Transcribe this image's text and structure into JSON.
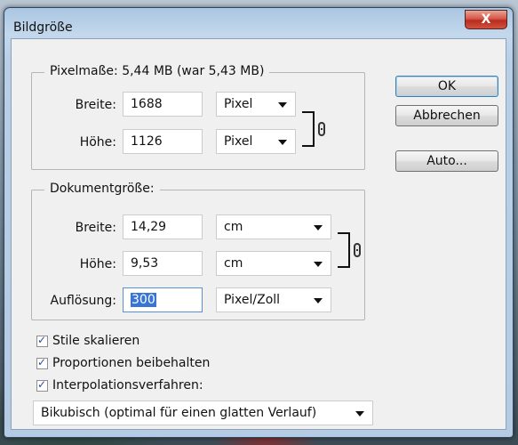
{
  "window": {
    "title": "Bildgröße",
    "close_label": "X"
  },
  "pixel_dimensions": {
    "legend": "Pixelmaße: 5,44 MB (war 5,43 MB)",
    "width_label": "Breite:",
    "width_value": "1688",
    "width_unit": "Pixel",
    "height_label": "Höhe:",
    "height_value": "1126",
    "height_unit": "Pixel",
    "link_icon": "chain-link-icon"
  },
  "document_size": {
    "legend": "Dokumentgröße:",
    "width_label": "Breite:",
    "width_value": "14,29",
    "width_unit": "cm",
    "height_label": "Höhe:",
    "height_value": "9,53",
    "height_unit": "cm",
    "resolution_label": "Auflösung:",
    "resolution_value": "300",
    "resolution_unit": "Pixel/Zoll",
    "link_icon": "chain-link-icon"
  },
  "buttons": {
    "ok": "OK",
    "cancel": "Abbrechen",
    "auto": "Auto..."
  },
  "options": {
    "scale_styles": {
      "label": "Stile skalieren",
      "checked": true
    },
    "constrain_proportions": {
      "label": "Proportionen beibehalten",
      "checked": true
    },
    "resample": {
      "label": "Interpolationsverfahren:",
      "checked": true
    }
  },
  "resample_method": {
    "selected": "Bikubisch (optimal für einen glatten Verlauf)"
  },
  "colors": {
    "selection": "#3875d7",
    "close_button": "#c9402f",
    "title_bar": "#b9cfe6"
  }
}
